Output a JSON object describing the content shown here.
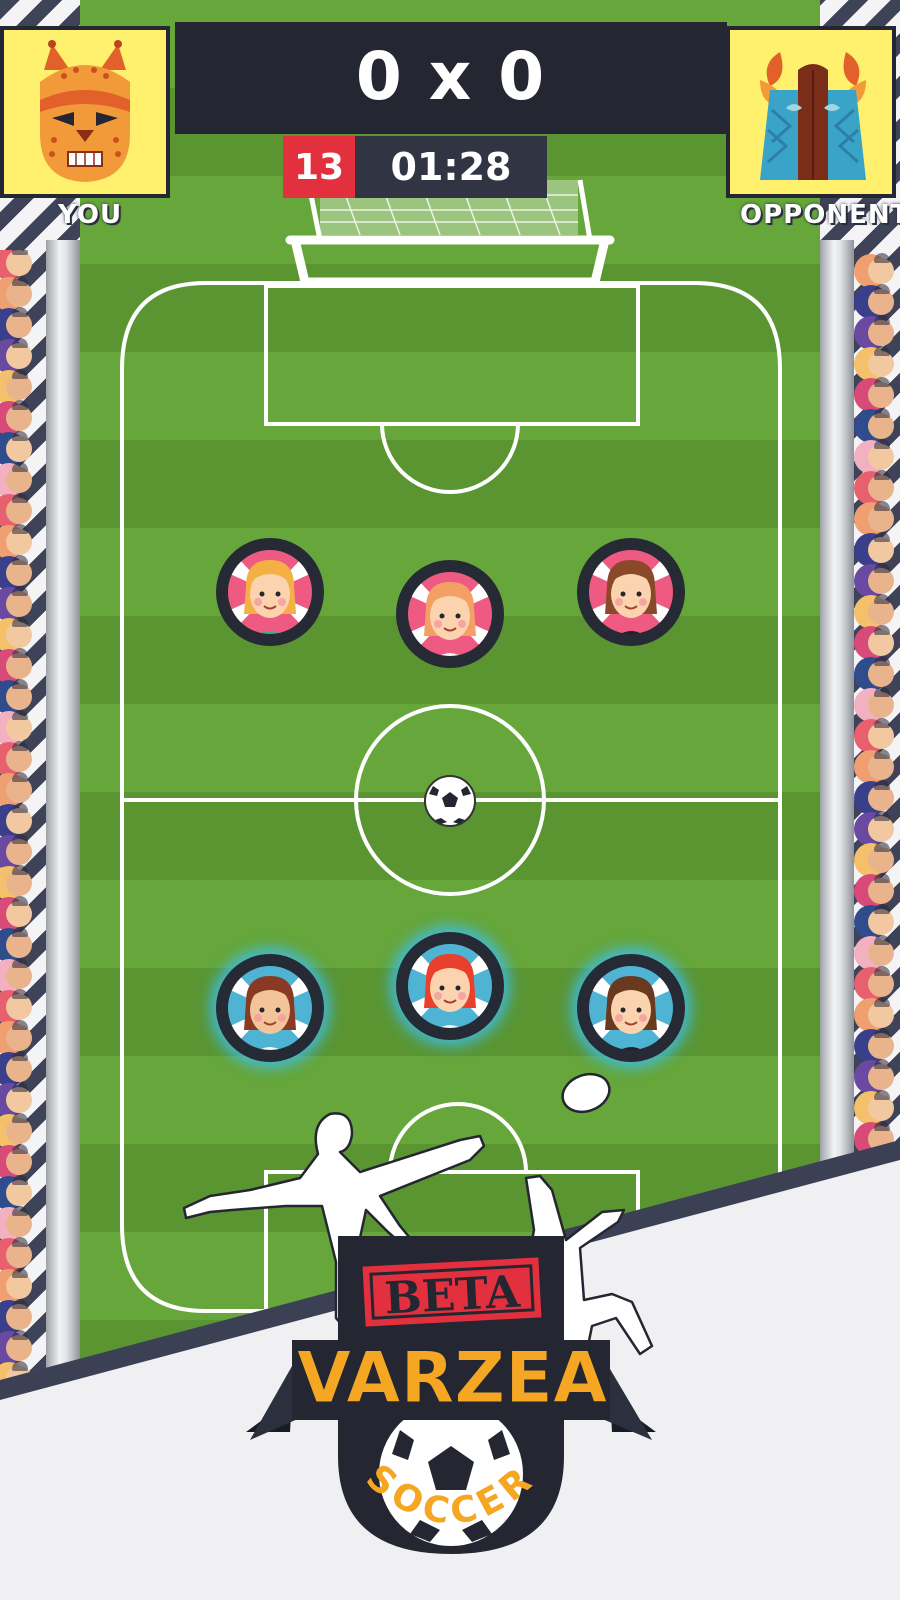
{
  "scoreboard": {
    "score": "0 x 0",
    "turns_left": "13",
    "timer": "01:28"
  },
  "players": {
    "you_label": "YOU",
    "opponent_label": "OPPONENT",
    "you_avatar": "jaguar-mask-icon",
    "opponent_avatar": "tribal-mask-icon"
  },
  "pieces": {
    "away": [
      {
        "name": "away-player-left",
        "hair": "#f4b045",
        "skin": "#fbd3ae",
        "shirt": "#39b07c"
      },
      {
        "name": "away-player-center",
        "hair": "#f4a064",
        "skin": "#fbd3ae",
        "shirt": "#f5f5f5"
      },
      {
        "name": "away-player-right",
        "hair": "#8a4a2a",
        "skin": "#fbd3ae",
        "shirt": "#222222"
      }
    ],
    "home": [
      {
        "name": "home-player-left",
        "hair": "#8a3a22",
        "skin": "#f3c49a",
        "shirt": "#f5f5f5"
      },
      {
        "name": "home-player-center",
        "hair": "#e8402c",
        "skin": "#fbd3ae",
        "shirt": "#f5f5f5"
      },
      {
        "name": "home-player-right",
        "hair": "#6a3a20",
        "skin": "#fbd3ae",
        "shirt": "#222222"
      }
    ]
  },
  "logo": {
    "badge": "BETA",
    "title": "VARZEA",
    "subtitle": "SOCCER"
  },
  "colors": {
    "team_away_ring": "#ef5a82",
    "team_home_ring": "#4fb4d4",
    "logo_orange": "#f5a623",
    "logo_red": "#e3303e",
    "dark_navy": "#242631"
  }
}
